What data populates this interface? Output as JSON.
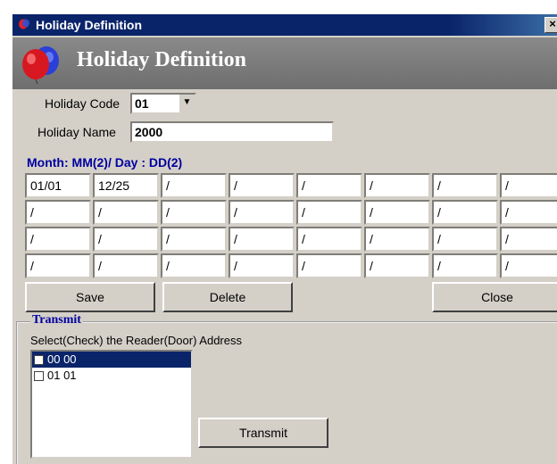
{
  "window": {
    "title": "Holiday Definition",
    "close_glyph": "×"
  },
  "banner": {
    "title": "Holiday Definition",
    "icon": "balloons-icon"
  },
  "form": {
    "code_label": "Holiday Code",
    "code_value": "01",
    "name_label": "Holiday Name",
    "name_value": "2000"
  },
  "grid": {
    "label": "Month: MM(2)/ Day : DD(2)",
    "rows": [
      [
        "01/01",
        "12/25",
        " /",
        " /",
        " /",
        " /",
        " /",
        " /"
      ],
      [
        " /",
        " /",
        " /",
        " /",
        " /",
        " /",
        " /",
        " /"
      ],
      [
        " /",
        " /",
        " /",
        " /",
        " /",
        " /",
        " /",
        " /"
      ],
      [
        " /",
        " /",
        " /",
        " /",
        " /",
        " /",
        " /",
        " /"
      ]
    ]
  },
  "buttons": {
    "save": "Save",
    "delete": "Delete",
    "close": "Close"
  },
  "transmit": {
    "group_title": "Transmit",
    "instruction": "Select(Check) the Reader(Door) Address",
    "items": [
      {
        "label": "00 00",
        "checked": false,
        "selected": true
      },
      {
        "label": "01 01",
        "checked": false,
        "selected": false
      }
    ],
    "button": "Transmit"
  },
  "colors": {
    "title_bar": "#0a246a",
    "banner": "#7b7b7b",
    "accent_text": "#0000a0",
    "face": "#d4d0c8"
  }
}
